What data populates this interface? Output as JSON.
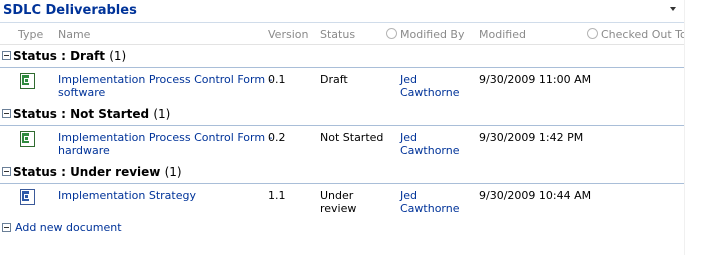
{
  "webpart": {
    "title": "SDLC Deliverables"
  },
  "columns": {
    "type": "Type",
    "name": "Name",
    "version": "Version",
    "status": "Status",
    "modified_by": "Modified By",
    "modified": "Modified",
    "checked_out_to": "Checked Out To"
  },
  "groups": [
    {
      "field": "Status",
      "separator": " : ",
      "value": "Draft",
      "count": "(1)",
      "rows": [
        {
          "icon": "excel-file-icon",
          "name_line1": "Implementation Process Control Form -",
          "name_line2": "software",
          "version": "0.1",
          "status_line1": "Draft",
          "status_line2": "",
          "modified_by_line1": "Jed",
          "modified_by_line2": "Cawthorne",
          "modified": "9/30/2009 11:00 AM"
        }
      ]
    },
    {
      "field": "Status",
      "separator": " : ",
      "value": "Not Started",
      "count": "(1)",
      "rows": [
        {
          "icon": "excel-file-icon",
          "name_line1": "Implementation Process Control Form -",
          "name_line2": "hardware",
          "version": "0.2",
          "status_line1": "Not Started",
          "status_line2": "",
          "modified_by_line1": "Jed",
          "modified_by_line2": "Cawthorne",
          "modified": "9/30/2009 1:42 PM"
        }
      ]
    },
    {
      "field": "Status",
      "separator": " : ",
      "value": "Under review",
      "count": "(1)",
      "rows": [
        {
          "icon": "word-file-icon",
          "name_line1": "Implementation Strategy",
          "name_line2": "",
          "version": "1.1",
          "status_line1": "Under",
          "status_line2": "review",
          "modified_by_line1": "Jed",
          "modified_by_line2": "Cawthorne",
          "modified": "9/30/2009 10:44 AM"
        }
      ]
    }
  ],
  "footer": {
    "add_new": "Add new document"
  }
}
